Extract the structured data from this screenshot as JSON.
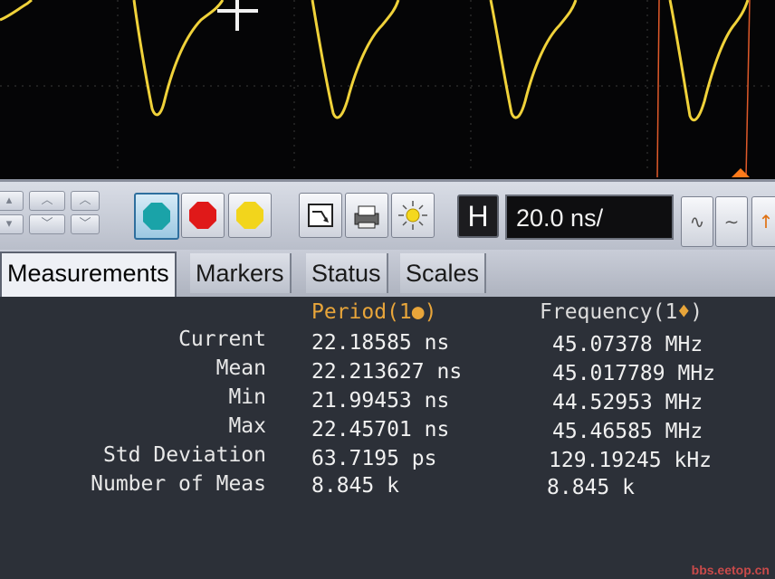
{
  "toolbar": {
    "timebase_label": "H",
    "timebase_value": "20.0 ns/",
    "color_buttons": [
      {
        "name": "channel-teal",
        "color": "#1aa3a8",
        "active": true
      },
      {
        "name": "channel-red",
        "color": "#e01919",
        "active": false
      },
      {
        "name": "channel-yellow",
        "color": "#f2d51c",
        "active": false
      }
    ]
  },
  "tabs": [
    {
      "label": "Measurements",
      "active": true
    },
    {
      "label": "Markers",
      "active": false
    },
    {
      "label": "Status",
      "active": false
    },
    {
      "label": "Scales",
      "active": false
    }
  ],
  "measurements": {
    "columns": [
      {
        "label": "Period(1",
        "marker": "●",
        "suffix": ")",
        "color": "#e8a53a"
      },
      {
        "label": "Frequency(1",
        "marker": "♦",
        "suffix": ")",
        "color": "#dcdcdc"
      }
    ],
    "rows": [
      {
        "label": "Current",
        "period": "22.18585 ns",
        "frequency": "45.07378 MHz"
      },
      {
        "label": "Mean",
        "period": "22.213627 ns",
        "frequency": "45.017789 MHz"
      },
      {
        "label": "Min",
        "period": "21.99453 ns",
        "frequency": "44.52953 MHz"
      },
      {
        "label": "Max",
        "period": "22.45701 ns",
        "frequency": "45.46585 MHz"
      },
      {
        "label": "Std Deviation",
        "period": "63.7195 ps",
        "frequency": "129.19245 kHz"
      },
      {
        "label": "Number of Meas",
        "period": "8.845 k",
        "frequency": "8.845 k"
      }
    ]
  },
  "colors": {
    "waveform": "#f0d23a",
    "grid": "#3a3a3a",
    "marker_line": "#e05a2a",
    "panel_bg": "#2c3038"
  },
  "watermark": "bbs.eetop.cn"
}
